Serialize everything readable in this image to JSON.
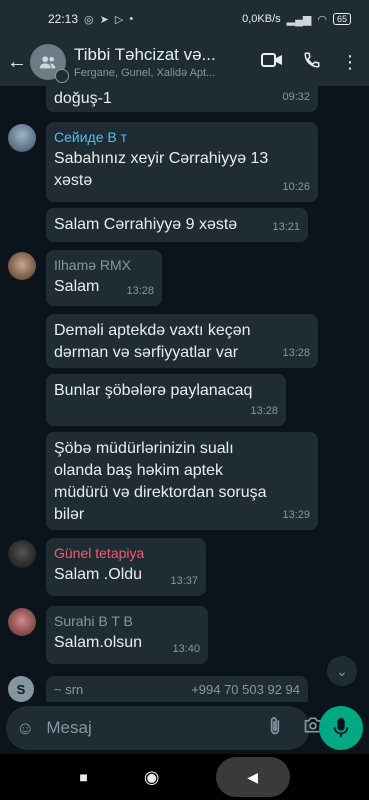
{
  "status_bar": {
    "time": "22:13",
    "net_speed": "0,0KB/s",
    "battery": "65"
  },
  "header": {
    "title": "Tibbi Təhcizat və...",
    "subtitle": "Fergane, Gunel, Xalidə Apt..."
  },
  "messages": [
    {
      "text": "doğuş-1",
      "time": "09:32"
    },
    {
      "sender": "Сейиде В т",
      "sender_color": "#53bdeb",
      "text": "Sabahınız xeyir Cərrahiyyə 13 xəstə",
      "time": "10:26"
    },
    {
      "text": "Salam Cərrahiyyə 9 xəstə",
      "time": "13:21"
    },
    {
      "sender": "Ilhamə RMX",
      "sender_color": "#8696a0",
      "text": "Salam",
      "time": "13:28"
    },
    {
      "text": "Deməli aptekdə vaxtı keçən dərman və sərfiyyatlar var",
      "time": "13:28"
    },
    {
      "text": "Bunlar şöbələrə paylanacaq",
      "time": "13:28"
    },
    {
      "text": "Şöbə müdürlərinizin sualı olanda baş həkim aptek müdürü və direktordan soruşa bilər",
      "time": "13:29"
    },
    {
      "sender": "Günel tetapiya",
      "sender_color": "#f15c6d",
      "text": "Salam .Oldu",
      "time": "13:37"
    },
    {
      "sender": "Surahi B T B",
      "sender_color": "#8696a0",
      "text": "Salam.olsun",
      "time": "13:40"
    }
  ],
  "partial": {
    "avatar_letter": "S",
    "name": "~ srn",
    "phone": "+994 70 503 92 94"
  },
  "composer": {
    "placeholder": "Mesaj"
  },
  "colors": {
    "accent": "#00a884",
    "bubble": "#202c33",
    "background": "#0b141a"
  }
}
